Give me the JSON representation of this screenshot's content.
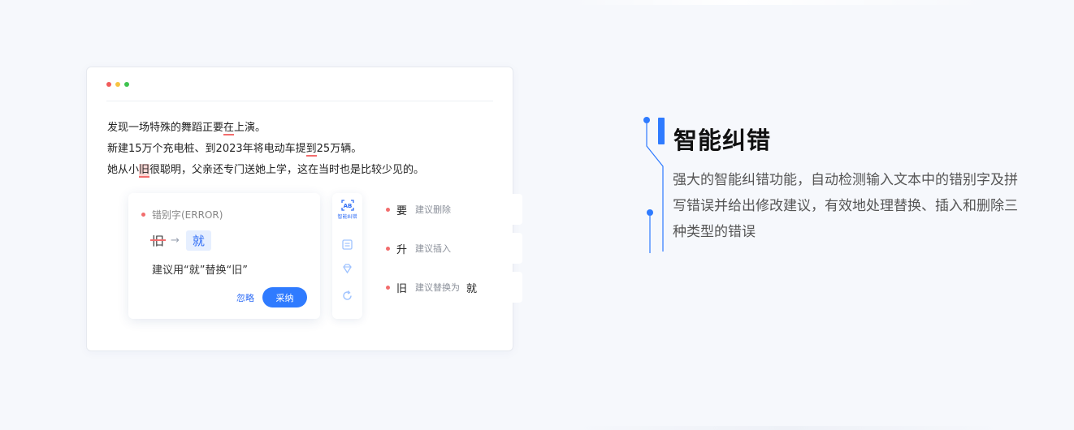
{
  "editor": {
    "lines": [
      {
        "pre": "发现一场特殊的舞蹈正要",
        "err": "在",
        "post": "上演。"
      },
      {
        "pre": "新建15万个充电桩、到2023年将电动车提",
        "err": "到",
        "post": "25万辆。"
      },
      {
        "pre": "她从小",
        "err": "旧",
        "post": "很聪明，父亲还专门送她上学，这在当时也是比较少见的。"
      }
    ]
  },
  "card": {
    "type_label": "错别字(ERROR)",
    "old_word": "旧",
    "arrow": "→",
    "new_word": "就",
    "suggestion": "建议用“就”替换“旧”",
    "ignore_label": "忽略",
    "adopt_label": "采纳"
  },
  "toolstrip": {
    "active_icon_text": "AB",
    "active_label": "智能纠错"
  },
  "items": [
    {
      "char": "要",
      "desc": "建议删除",
      "target": ""
    },
    {
      "char": "升",
      "desc": "建议插入",
      "target": ""
    },
    {
      "char": "旧",
      "desc": "建议替换为",
      "target": "就"
    }
  ],
  "feature": {
    "title": "智能纠错",
    "description": "强大的智能纠错功能，自动检测输入文本中的错别字及拼写错误并给出修改建议，有效地处理替换、插入和删除三种类型的错误"
  },
  "colors": {
    "accent": "#2f7bff",
    "error": "#f26d6d",
    "background": "#f6f8fc"
  }
}
